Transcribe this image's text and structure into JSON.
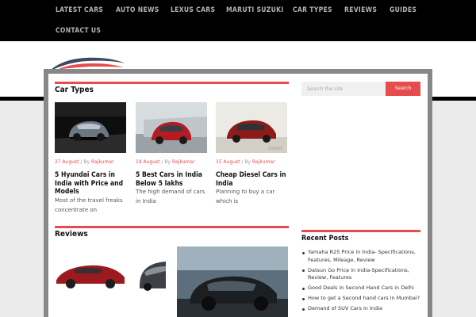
{
  "nav": {
    "items": [
      {
        "label": "LATEST CARS"
      },
      {
        "label": "AUTO NEWS"
      },
      {
        "label": "LEXUS CARS"
      },
      {
        "label": "MARUTI SUZUKI"
      },
      {
        "label": "CAR TYPES"
      },
      {
        "label": "REVIEWS"
      },
      {
        "label": "GUIDES"
      },
      {
        "label": "CONTACT US"
      }
    ]
  },
  "logo": {
    "icon": "car-silhouette-logo"
  },
  "car_types": {
    "title": "Car Types",
    "cards": [
      {
        "date": "27 August",
        "by": "/ By",
        "author": "Rajkumar",
        "title": "5 Hyundai Cars in India with Price and Models",
        "excerpt": "Most of the travel freaks concentrate on"
      },
      {
        "date": "19 August",
        "by": "/ By",
        "author": "Rajkumar",
        "title": "5 Best Cars in India Below 5 lakhs",
        "excerpt": "The high demand of cars in India"
      },
      {
        "date": "15 August",
        "by": "/ By",
        "author": "Rajkumar",
        "title": "Cheap Diesel Cars in India",
        "excerpt": "Planning to buy a car which is"
      }
    ]
  },
  "reviews": {
    "title": "Reviews"
  },
  "search": {
    "placeholder": "Search the site",
    "button": "Search"
  },
  "recent_posts": {
    "title": "Recent Posts",
    "items": [
      "Yamaha R25 Price in India- Specifications, Features, Mileage, Review",
      "Datsun Go Price in India-Specifications, Review, Features",
      "Good Deals in Second Hand Cars in Delhi",
      "How to get a Second hand cars in Mumbai?",
      "Demand of SUV Cars in India"
    ]
  },
  "colors": {
    "accent": "#e74c4c",
    "nav_bg": "#000000",
    "nav_text": "#b3b3b3"
  }
}
